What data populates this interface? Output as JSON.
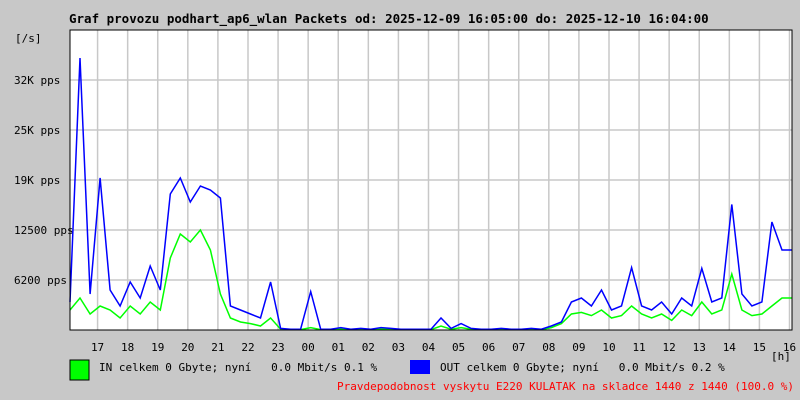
{
  "chart_data": {
    "type": "line",
    "title": "Graf provozu podhart_ap6_wlan Packets od: 2025-12-09 16:05:00 do: 2025-12-10 16:04:00",
    "ylabel": "[/s]",
    "xlabel": "[h]",
    "ylim": [
      0,
      37500
    ],
    "y_ticks": [
      {
        "value": 6200,
        "label": "6200 pps"
      },
      {
        "value": 12500,
        "label": "12500 pps"
      },
      {
        "value": 19000,
        "label": "19K pps"
      },
      {
        "value": 25000,
        "label": "25K pps"
      },
      {
        "value": 32000,
        "label": "32K pps"
      }
    ],
    "x_start": "16:05",
    "x_step_minutes": 20,
    "x_tick_labels": [
      "17",
      "18",
      "19",
      "20",
      "21",
      "22",
      "23",
      "00",
      "01",
      "02",
      "03",
      "04",
      "05",
      "06",
      "07",
      "08",
      "09",
      "10",
      "11",
      "12",
      "13",
      "14",
      "15",
      "16"
    ],
    "grid": true,
    "series": [
      {
        "name": "IN",
        "color": "#00ff00",
        "values": [
          2500,
          4000,
          2000,
          3000,
          2500,
          1500,
          3000,
          2000,
          3500,
          2500,
          9000,
          12000,
          11000,
          12500,
          10000,
          4500,
          1500,
          1000,
          800,
          500,
          1500,
          100,
          50,
          50,
          300,
          50,
          50,
          100,
          50,
          100,
          50,
          100,
          100,
          50,
          50,
          50,
          50,
          500,
          100,
          300,
          100,
          50,
          50,
          100,
          50,
          50,
          100,
          50,
          300,
          800,
          2000,
          2200,
          1800,
          2500,
          1500,
          1800,
          3000,
          2000,
          1500,
          2000,
          1200,
          2500,
          1800,
          3500,
          2000,
          2500,
          7000,
          2500,
          1800,
          2000,
          3000,
          4000
        ]
      },
      {
        "name": "OUT",
        "color": "#0000ff",
        "values": [
          3500,
          34000,
          4500,
          19000,
          5000,
          3000,
          6000,
          4000,
          8000,
          5000,
          17000,
          19000,
          16000,
          18000,
          17500,
          16500,
          3000,
          2500,
          2000,
          1500,
          6000,
          200,
          100,
          100,
          4800,
          100,
          100,
          300,
          100,
          200,
          100,
          300,
          200,
          100,
          100,
          100,
          100,
          1500,
          200,
          800,
          200,
          100,
          100,
          200,
          100,
          100,
          200,
          100,
          500,
          1000,
          3500,
          4000,
          3000,
          5000,
          2500,
          3000,
          7800,
          3000,
          2500,
          3500,
          2000,
          4000,
          3000,
          7700,
          3500,
          4000,
          15700,
          4500,
          3000,
          3500,
          13500,
          10000
        ]
      }
    ]
  },
  "legend": {
    "in_text": "IN celkem 0 Gbyte; nyní   0.0 Mbit/s 0.1 %",
    "out_text": "OUT celkem 0 Gbyte; nyní   0.0 Mbit/s 0.2 %",
    "in_color": "#00ff00",
    "out_color": "#0000ff"
  },
  "footer": {
    "note": "Pravdepodobnost vyskytu E220 KULATAK na skladce 1440 z 1440 (100.0 %)",
    "color": "#ff0000"
  }
}
